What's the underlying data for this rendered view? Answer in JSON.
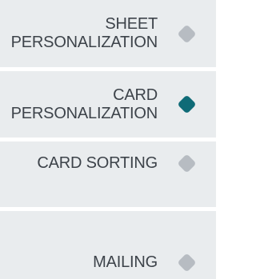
{
  "steps": [
    {
      "label": "SHEET\nPERSONALIZATION",
      "state": "inactive"
    },
    {
      "label": "CARD\nPERSONALIZATION",
      "state": "active"
    },
    {
      "label": "CARD SORTING",
      "state": "inactive"
    },
    {
      "label": "MAILING",
      "state": "inactive"
    }
  ],
  "colors": {
    "active_dot": "#0f6b77",
    "inactive_dot": "#b7bcc2",
    "label_text": "#3d434a",
    "band_background": "#e9ecee"
  }
}
